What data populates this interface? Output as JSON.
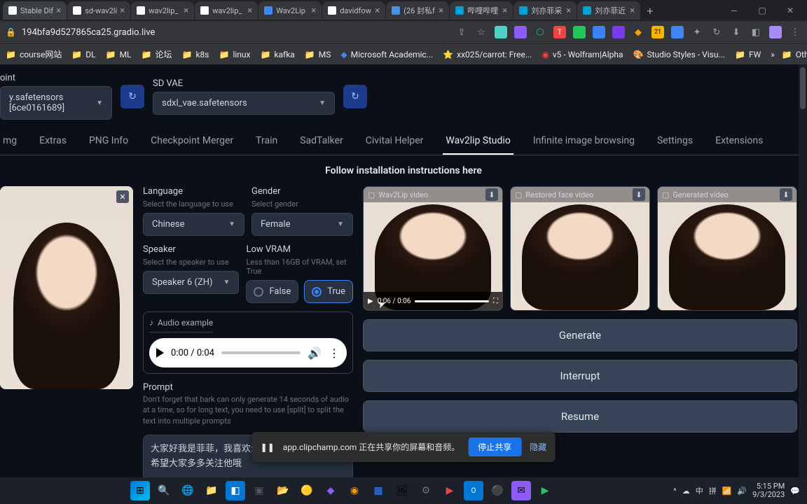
{
  "browser": {
    "tabs": [
      {
        "title": "Stable Dif"
      },
      {
        "title": "sd-wav2li"
      },
      {
        "title": "wav2lip_"
      },
      {
        "title": "wav2lip_"
      },
      {
        "title": "Wav2Lip"
      },
      {
        "title": "davidfow"
      },
      {
        "title": "(26 封私f"
      },
      {
        "title": "哔哩哔哩"
      },
      {
        "title": "刘亦菲采"
      },
      {
        "title": "刘亦菲近"
      }
    ],
    "url": "194bfa9d527865ca25.gradio.live",
    "bookmarks": [
      "course网站",
      "DL",
      "ML",
      "论坛",
      "k8s",
      "linux",
      "kafka",
      "MS",
      "Microsoft Academic...",
      "xx025/carrot: Free...",
      "v5 - Wolfram|Alpha",
      "Studio Styles - Visu...",
      "FW"
    ],
    "other_bookmarks": "Other bookmarks",
    "ext_badge": "21"
  },
  "app": {
    "checkpoint_label": "oint",
    "checkpoint_value": "y.safetensors [6ce0161689]",
    "vae_label": "SD VAE",
    "vae_value": "sdxl_vae.safetensors",
    "tabs": [
      "mg",
      "Extras",
      "PNG Info",
      "Checkpoint Merger",
      "Train",
      "SadTalker",
      "Civitai Helper",
      "Wav2lip Studio",
      "Infinite image browsing",
      "Settings",
      "Extensions"
    ],
    "active_tab": "Wav2lip Studio",
    "banner": "Follow installation instructions here",
    "language": {
      "label": "Language",
      "hint": "Select the language to use",
      "value": "Chinese"
    },
    "gender": {
      "label": "Gender",
      "hint": "Select gender",
      "value": "Female"
    },
    "speaker": {
      "label": "Speaker",
      "hint": "Select the speaker to use",
      "value": "Speaker 6 (ZH)"
    },
    "lowvram": {
      "label": "Low VRAM",
      "hint": "Less than 16GB of VRAM, set True",
      "false": "False",
      "true": "True",
      "selected": "True"
    },
    "audio": {
      "label": "Audio example",
      "time": "0:00 / 0:04"
    },
    "prompt": {
      "label": "Prompt",
      "hint": "Don't forget that bark can only generate 14 seconds of audio at a time, so for long text, you need to use [split] to split the text into multiple prompts",
      "value": "大家好我是菲菲，我喜欢幻影天河和他的视频，希望大家多多关注他哦"
    },
    "videos": {
      "v1": "Wav2Lip video",
      "v2": "Restored face video",
      "v3": "Generated video",
      "time": "0:06  /  0:06"
    },
    "buttons": {
      "generate": "Generate",
      "interrupt": "Interrupt",
      "resume": "Resume"
    }
  },
  "share": {
    "text": "app.clipchamp.com 正在共享你的屏幕和音频。",
    "stop": "停止共享",
    "hide": "隐藏"
  },
  "taskbar": {
    "time": "5:15 PM",
    "date": "9/3/2023",
    "lang1": "中",
    "lang2": "拼"
  }
}
